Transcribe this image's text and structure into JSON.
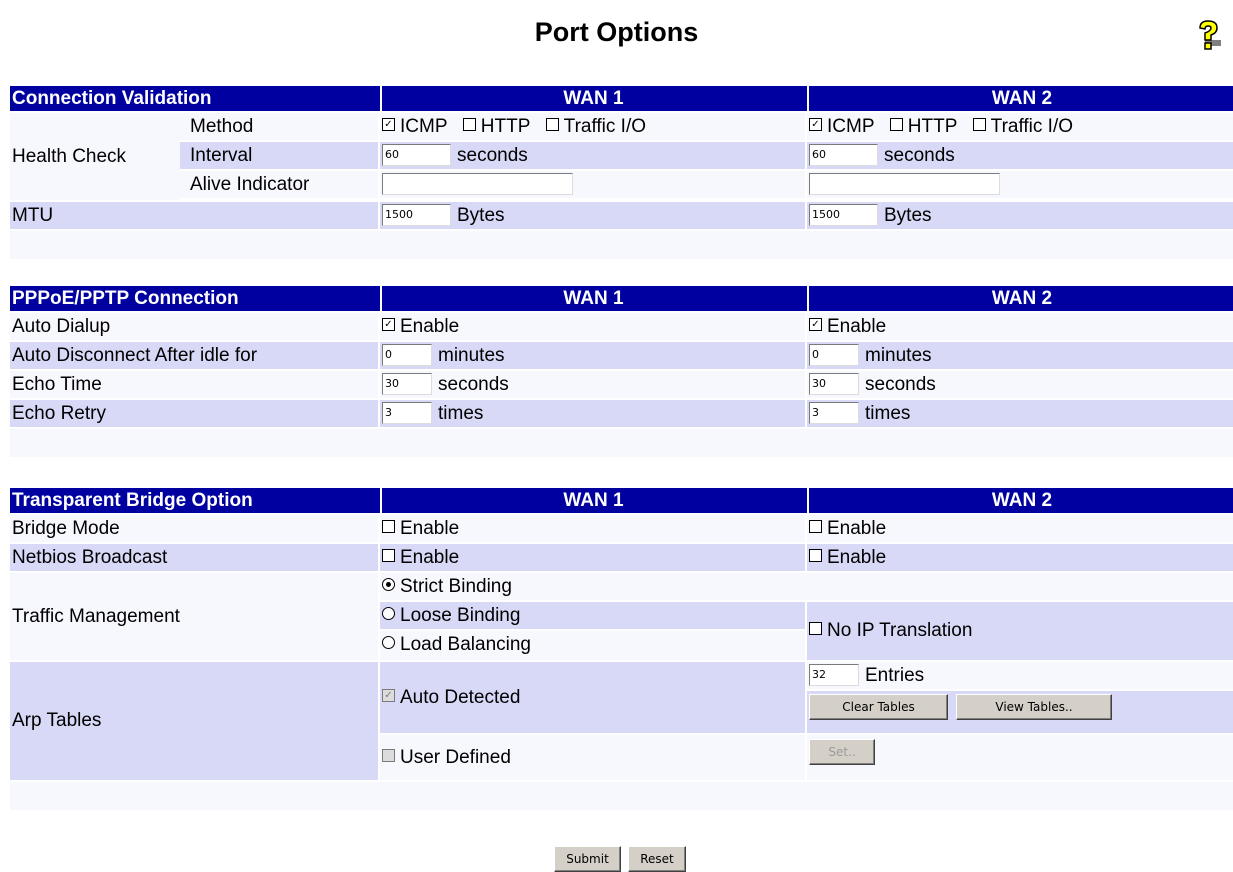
{
  "page": {
    "title": "Port Options",
    "help_icon": "help-question-icon"
  },
  "common": {
    "wan1": "WAN 1",
    "wan2": "WAN 2",
    "enable": "Enable"
  },
  "connection_validation": {
    "header": "Connection Validation",
    "health_check": "Health Check",
    "method_label": "Method",
    "methods": [
      "ICMP",
      "HTTP",
      "Traffic I/O"
    ],
    "wan1_methods_checked": [
      true,
      false,
      false
    ],
    "wan2_methods_checked": [
      true,
      false,
      false
    ],
    "interval_label": "Interval",
    "interval_unit": "seconds",
    "wan1_interval": "60",
    "wan2_interval": "60",
    "alive_label": "Alive Indicator",
    "wan1_alive": "",
    "wan2_alive": "",
    "mtu_label": "MTU",
    "mtu_unit": "Bytes",
    "wan1_mtu": "1500",
    "wan2_mtu": "1500"
  },
  "pppoe": {
    "header": "PPPoE/PPTP Connection",
    "auto_dialup_label": "Auto Dialup",
    "wan1_auto_dialup": true,
    "wan2_auto_dialup": true,
    "auto_disconnect_label": "Auto Disconnect After idle for",
    "minutes_unit": "minutes",
    "wan1_idle": "0",
    "wan2_idle": "0",
    "echo_time_label": "Echo Time",
    "seconds_unit": "seconds",
    "wan1_echo_time": "30",
    "wan2_echo_time": "30",
    "echo_retry_label": "Echo Retry",
    "times_unit": "times",
    "wan1_echo_retry": "3",
    "wan2_echo_retry": "3"
  },
  "bridge": {
    "header": "Transparent Bridge Option",
    "bridge_mode_label": "Bridge Mode",
    "netbios_label": "Netbios Broadcast",
    "traffic_label": "Traffic Management",
    "strict": "Strict Binding",
    "loose": "Loose Binding",
    "load": "Load Balancing",
    "selected_mode": "Strict Binding",
    "no_ip": "No IP Translation",
    "arp_label": "Arp Tables",
    "auto_detected": "Auto Detected",
    "user_defined": "User Defined",
    "entries_value": "32",
    "entries_unit": "Entries",
    "clear_tables": "Clear Tables",
    "view_tables": "View Tables..",
    "set": "Set.."
  },
  "footer": {
    "submit": "Submit",
    "reset": "Reset"
  }
}
